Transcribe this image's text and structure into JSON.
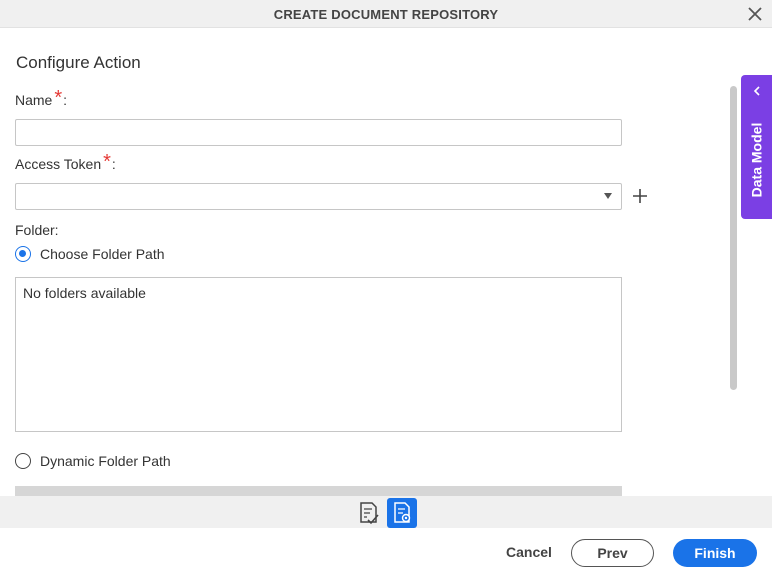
{
  "dialog": {
    "title": "CREATE DOCUMENT REPOSITORY",
    "close_icon": "close-icon"
  },
  "form": {
    "heading": "Configure Action",
    "name": {
      "label": "Name",
      "required_mark": "*",
      "colon": ":",
      "value": ""
    },
    "access_token": {
      "label": "Access Token",
      "required_mark": "*",
      "colon": ":",
      "value": ""
    },
    "folder": {
      "label": "Folder:",
      "choose_path_label": "Choose Folder Path",
      "choose_path_selected": true,
      "empty_text": "No folders available",
      "dynamic_path_label": "Dynamic Folder Path",
      "dynamic_path_selected": false
    }
  },
  "side_panel": {
    "label": "Data Model",
    "chevron_icon": "chevron-left-icon"
  },
  "toolbar": {
    "icons": [
      "document-check-icon",
      "document-settings-icon"
    ],
    "active_index": 1
  },
  "footer": {
    "cancel_label": "Cancel",
    "prev_label": "Prev",
    "finish_label": "Finish"
  },
  "colors": {
    "primary": "#1a73e8",
    "side_panel": "#7b3fe4",
    "required": "#e53935"
  }
}
